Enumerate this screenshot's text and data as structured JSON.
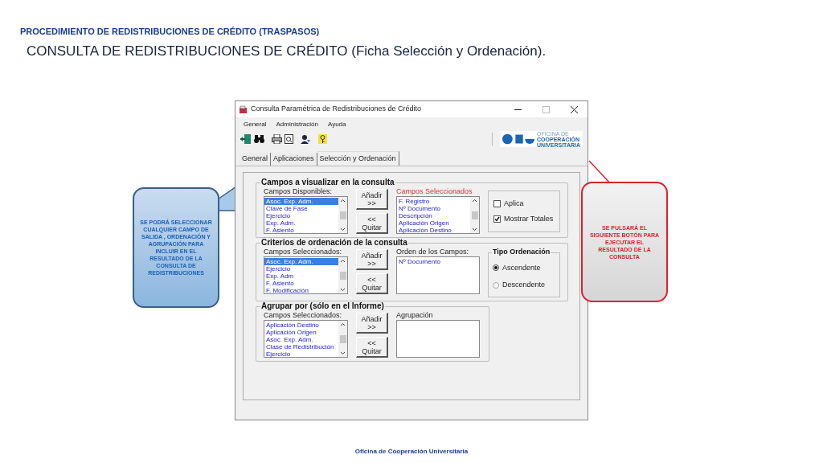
{
  "slide": {
    "header": "PROCEDIMIENTO DE REDISTRIBUCIONES DE CRÉDITO (TRASPASOS)",
    "title": "CONSULTA DE REDISTRIBUCIONES DE CRÉDITO (Ficha Selección y Ordenación).",
    "footer": "Oficina de Cooperación Universitaria"
  },
  "window": {
    "title": "Consulta Paramétrica de Redistribuciones de Crédito",
    "menu": [
      "General",
      "Administración",
      "Ayuda"
    ],
    "logo_text": [
      "OFICINA DE",
      "COOPERACIÓN",
      "UNIVERSITARIA"
    ],
    "tabs": [
      {
        "label": "General",
        "selected": false
      },
      {
        "label": "Aplicaciones",
        "selected": false
      },
      {
        "label": "Selección y Ordenación",
        "selected": true
      }
    ],
    "display_group": {
      "title": "Campos a visualizar en la consulta",
      "add_button": [
        "Añadir",
        ">>"
      ],
      "remove_button": [
        "<<",
        "Quitar"
      ],
      "available": {
        "label": "Campos Disponibles:",
        "highlighted": false,
        "items": [
          {
            "text": "Asoc. Exp. Adm.",
            "selected": true
          },
          {
            "text": "Clave de Fase",
            "selected": false
          },
          {
            "text": "Ejercicio",
            "selected": false
          },
          {
            "text": "Exp. Adm.",
            "selected": false
          },
          {
            "text": "F. Asiento",
            "selected": false
          }
        ]
      },
      "chosen": {
        "label": "Campos Seleccionados",
        "highlighted": true,
        "items": [
          {
            "text": "F. Registro",
            "selected": false
          },
          {
            "text": "Nº Documento",
            "selected": false
          },
          {
            "text": "Descripción",
            "selected": false
          },
          {
            "text": "Aplicación Origen",
            "selected": false
          },
          {
            "text": "Aplicación Destino",
            "selected": false
          }
        ]
      },
      "options": [
        {
          "label": "Aplica",
          "checked": false
        },
        {
          "label": "Mostrar Totales",
          "checked": true
        }
      ]
    },
    "order_group": {
      "title": "Criterios de ordenación de la consulta",
      "add_button": [
        "Añadir",
        ">>"
      ],
      "remove_button": [
        "<<",
        "Quitar"
      ],
      "available": {
        "label": "Campos Seleccionados:",
        "highlighted": false,
        "items": [
          {
            "text": "Asoc. Exp. Adm.",
            "selected": true
          },
          {
            "text": "Ejercicio",
            "selected": false
          },
          {
            "text": "Exp. Adm",
            "selected": false
          },
          {
            "text": "F. Asiento",
            "selected": false
          },
          {
            "text": "F. Modificación",
            "selected": false
          }
        ]
      },
      "chosen": {
        "label": "Orden de los Campos:",
        "highlighted": false,
        "items": [
          {
            "text": "Nº Documento",
            "selected": false
          }
        ]
      },
      "order_type": {
        "title": "Tipo Ordenación",
        "options": [
          {
            "label": "Ascendente",
            "selected": true
          },
          {
            "label": "Descendente",
            "selected": false
          }
        ]
      }
    },
    "group_group": {
      "title": "Agrupar por (sólo en el Informe)",
      "add_button": [
        "Añadir",
        ">>"
      ],
      "remove_button": [
        "<<",
        "Quitar"
      ],
      "available": {
        "label": "Campos Seleccionados:",
        "highlighted": false,
        "items": [
          {
            "text": "Aplicación Destino",
            "selected": false
          },
          {
            "text": "Aplicación Origen",
            "selected": false
          },
          {
            "text": "Asoc. Exp. Adm.",
            "selected": false
          },
          {
            "text": "Clase de Redistribución",
            "selected": false
          },
          {
            "text": "Ejercicio",
            "selected": false
          }
        ]
      },
      "chosen": {
        "label": "Agrupación",
        "highlighted": false
      }
    }
  },
  "callouts": [
    {
      "kind": "info",
      "text": "SE PODRÁ SELECCIONAR CUALQUIER CAMPO DE SALIDA , ORDENACIÓN Y AGRUPACIÓN PARA INCLUIR EN EL RESULTADO DE LA CONSULTA DE REDISTRIBUCIONES"
    },
    {
      "kind": "action",
      "text": "SE PULSARÁ EL SIGUIENTE BOTÓN PARA EJECUTAR EL RESULTADO DE LA CONSULTA"
    }
  ]
}
